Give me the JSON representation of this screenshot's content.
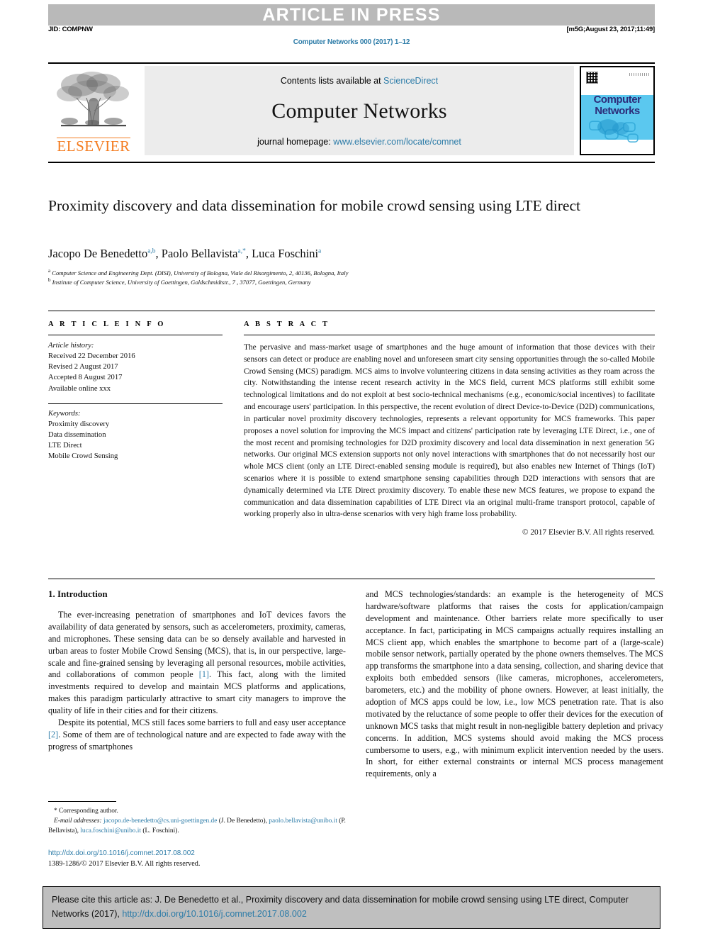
{
  "banner": {
    "article_in_press": "ARTICLE IN PRESS",
    "jid": "JID: COMPNW",
    "stamp": "[m5G;August 23, 2017;11:49]",
    "journal_ref": "Computer Networks 000 (2017) 1–12"
  },
  "masthead": {
    "contents_prefix": "Contents lists available at ",
    "contents_link": "ScienceDirect",
    "journal_title": "Computer Networks",
    "homepage_prefix": "journal homepage: ",
    "homepage_link": "www.elsevier.com/locate/comnet",
    "publisher": "ELSEVIER",
    "cover_title_line1": "Computer",
    "cover_title_line2": "Networks"
  },
  "article": {
    "title": "Proximity discovery and data dissemination for mobile crowd sensing using LTE direct",
    "authors_html": "Jacopo De Benedetto<sup>a,b</sup>, Paolo Bellavista<sup>a,*</sup>, Luca Foschini<sup>a</sup>",
    "authors_plain": "Jacopo De Benedetto a,b, Paolo Bellavista a,*, Luca Foschini a",
    "affiliation_a": "Computer Science and Engineering Dept. (DISI), University of Bologna, Viale del Risorgimento, 2, 40136, Bologna, Italy",
    "affiliation_b": "Institute of Computer Science, University of Goettingen, Goldschmidtstr., 7 , 37077, Goettingen, Germany"
  },
  "info": {
    "heading": "A R T I C L E    I N F O",
    "history_label": "Article history:",
    "history": [
      "Received 22 December 2016",
      "Revised 2 August 2017",
      "Accepted 8 August 2017",
      "Available online xxx"
    ],
    "keywords_label": "Keywords:",
    "keywords": [
      "Proximity discovery",
      "Data dissemination",
      "LTE Direct",
      "Mobile Crowd Sensing"
    ]
  },
  "abstract": {
    "heading": "A B S T R A C T",
    "text": "The pervasive and mass-market usage of smartphones and the huge amount of information that those devices with their sensors can detect or produce are enabling novel and unforeseen smart city sensing opportunities through the so-called Mobile Crowd Sensing (MCS) paradigm. MCS aims to involve volunteering citizens in data sensing activities as they roam across the city. Notwithstanding the intense recent research activity in the MCS field, current MCS platforms still exhibit some technological limitations and do not exploit at best socio-technical mechanisms (e.g., economic/social incentives) to facilitate and encourage users' participation. In this perspective, the recent evolution of direct Device-to-Device (D2D) communications, in particular novel proximity discovery technologies, represents a relevant opportunity for MCS frameworks. This paper proposes a novel solution for improving the MCS impact and citizens' participation rate by leveraging LTE Direct, i.e., one of the most recent and promising technologies for D2D proximity discovery and local data dissemination in next generation 5G networks. Our original MCS extension supports not only novel interactions with smartphones that do not necessarily host our whole MCS client (only an LTE Direct-enabled sensing module is required), but also enables new Internet of Things (IoT) scenarios where it is possible to extend smartphone sensing capabilities through D2D interactions with sensors that are dynamically determined via LTE Direct proximity discovery. To enable these new MCS features, we propose to expand the communication and data dissemination capabilities of LTE Direct via an original multi-frame transport protocol, capable of working properly also in ultra-dense scenarios with very high frame loss probability.",
    "copyright": "© 2017 Elsevier B.V. All rights reserved."
  },
  "body": {
    "section_heading": "1. Introduction",
    "left_paragraph_1_a": "The ever-increasing penetration of smartphones and IoT devices favors the availability of data generated by sensors, such as accelerometers, proximity, cameras, and microphones. These sensing data can be so densely available and harvested in urban areas to foster Mobile Crowd Sensing (MCS), that is, in our perspective, large-scale and fine-grained sensing by leveraging all personal resources, mobile activities, and collaborations of common people ",
    "left_paragraph_1_cite": "[1]",
    "left_paragraph_1_b": ". This fact, along with the limited investments required to develop and maintain MCS platforms and applications, makes this paradigm particularly attractive to smart city managers to improve the quality of life in their cities and for their citizens.",
    "left_paragraph_2_a": "Despite its potential, MCS still faces some barriers to full and easy user acceptance ",
    "left_paragraph_2_cite": "[2]",
    "left_paragraph_2_b": ". Some of them are of technological nature and are expected to fade away with the progress of smartphones",
    "right_paragraph": "and MCS technologies/standards: an example is the heterogeneity of MCS hardware/software platforms that raises the costs for application/campaign development and maintenance. Other barriers relate more specifically to user acceptance. In fact, participating in MCS campaigns actually requires installing an MCS client app, which enables the smartphone to become part of a (large-scale) mobile sensor network, partially operated by the phone owners themselves. The MCS app transforms the smartphone into a data sensing, collection, and sharing device that exploits both embedded sensors (like cameras, microphones, accelerometers, barometers, etc.) and the mobility of phone owners. However, at least initially, the adoption of MCS apps could be low, i.e., low MCS penetration rate. That is also motivated by the reluctance of some people to offer their devices for the execution of unknown MCS tasks that might result in non-negligible battery depletion and privacy concerns. In addition, MCS systems should avoid making the MCS process cumbersome to users, e.g., with minimum explicit intervention needed by the users. In short, for either external constraints or internal MCS process management requirements, only a"
  },
  "footnote": {
    "corresponding": "* Corresponding author.",
    "email_label": "E-mail addresses:",
    "email_1": "jacopo.de-benedetto@cs.uni-goettingen.de",
    "email_1_name": "(J. De Benedetto),",
    "email_2": "paolo.bellavista@unibo.it",
    "email_2_name": "(P. Bellavista),",
    "email_3": "luca.foschini@unibo.it",
    "email_3_name": "(L. Foschini).",
    "doi": "http://dx.doi.org/10.1016/j.comnet.2017.08.002",
    "issn_line": "1389-1286/© 2017 Elsevier B.V. All rights reserved."
  },
  "citation_box": {
    "text_a": "Please cite this article as: J. De Benedetto et al., Proximity discovery and data dissemination for mobile crowd sensing using LTE direct, Computer Networks (2017), ",
    "link": "http://dx.doi.org/10.1016/j.comnet.2017.08.002"
  },
  "colors": {
    "link": "#2d7ca8",
    "banner_bg": "#b9b9b9",
    "masthead_bg": "#ececec",
    "elsevier_orange": "#f47c20",
    "cover_blue": "#5bc8ef",
    "citation_bg": "#bfbfbf"
  }
}
